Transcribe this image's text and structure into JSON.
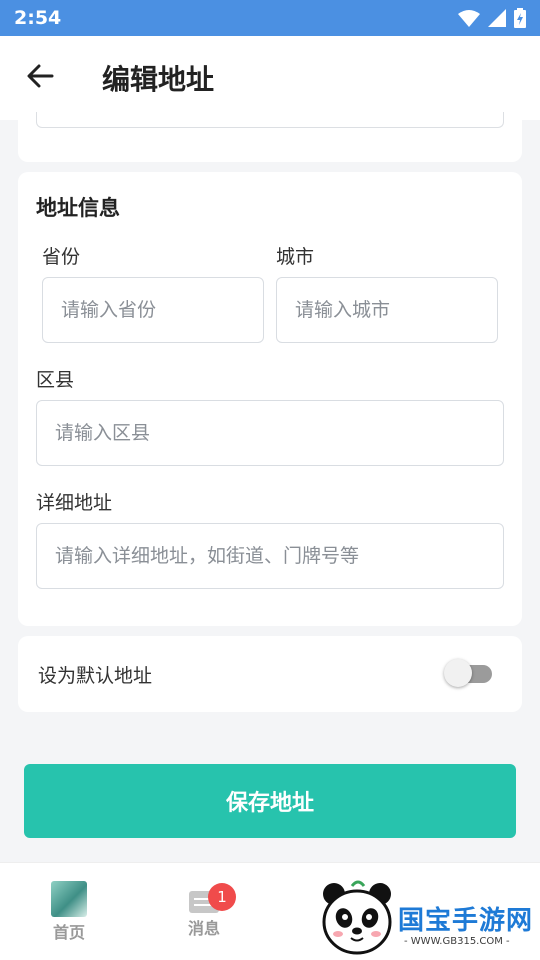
{
  "status_bar": {
    "time": "2:54"
  },
  "header": {
    "title": "编辑地址"
  },
  "address_section": {
    "title": "地址信息",
    "province": {
      "label": "省份",
      "placeholder": "请输入省份",
      "value": ""
    },
    "city": {
      "label": "城市",
      "placeholder": "请输入城市",
      "value": ""
    },
    "district": {
      "label": "区县",
      "placeholder": "请输入区县",
      "value": ""
    },
    "detail": {
      "label": "详细地址",
      "placeholder": "请输入详细地址，如街道、门牌号等",
      "value": ""
    }
  },
  "default_address": {
    "label": "设为默认地址",
    "enabled": false
  },
  "save_button": {
    "label": "保存地址"
  },
  "bottom_nav": {
    "home": {
      "label": "首页"
    },
    "messages": {
      "label": "消息",
      "badge": "1"
    }
  },
  "watermark": {
    "brand": "国宝手游网",
    "url": "- WWW.GB315.COM -"
  },
  "colors": {
    "status_bar": "#4b90e2",
    "accent": "#27c3ad",
    "badge": "#f04b4b"
  }
}
